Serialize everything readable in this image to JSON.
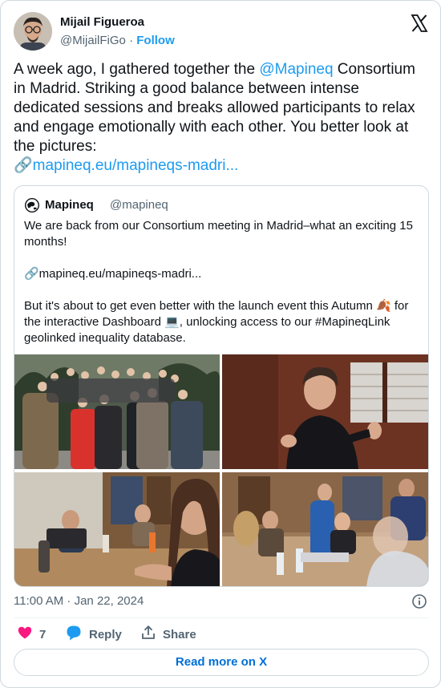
{
  "author": {
    "name": "Mijail Figueroa",
    "handle": "@MijailFiGo",
    "separator": " · ",
    "follow_label": "Follow"
  },
  "tweet": {
    "text_before": "A week ago, I gathered together the ",
    "mention": "@Mapineq",
    "text_after": " Consortium in Madrid. Striking a good balance between intense dedicated sessions and breaks allowed participants to relax and engage emotionally with each other. You better look at the pictures:\n",
    "link_emoji": "🔗",
    "link": "mapineq.eu/mapineqs-madri..."
  },
  "quoted": {
    "name": "Mapineq",
    "handle": "@mapineq",
    "text": "We are back from our Consortium meeting in Madrid–what an exciting 15 months!\n\n🔗mapineq.eu/mapineqs-madri...\n\nBut it's about to get even better with the launch event this Autumn 🍂 for the interactive Dashboard 💻, unlocking access to our #MapineqLink geolinked inequality database."
  },
  "timestamp": "11:00 AM · Jan 22, 2024",
  "actions": {
    "like_count": "7",
    "reply_label": "Reply",
    "share_label": "Share"
  },
  "read_more_label": "Read more on X",
  "colors": {
    "accent": "#1d9bf0",
    "like": "#f91880",
    "border": "#cfd9de",
    "muted": "#536471"
  },
  "icons": [
    "x-logo-icon",
    "globe-icon",
    "info-icon",
    "heart-icon",
    "reply-icon",
    "share-icon"
  ]
}
